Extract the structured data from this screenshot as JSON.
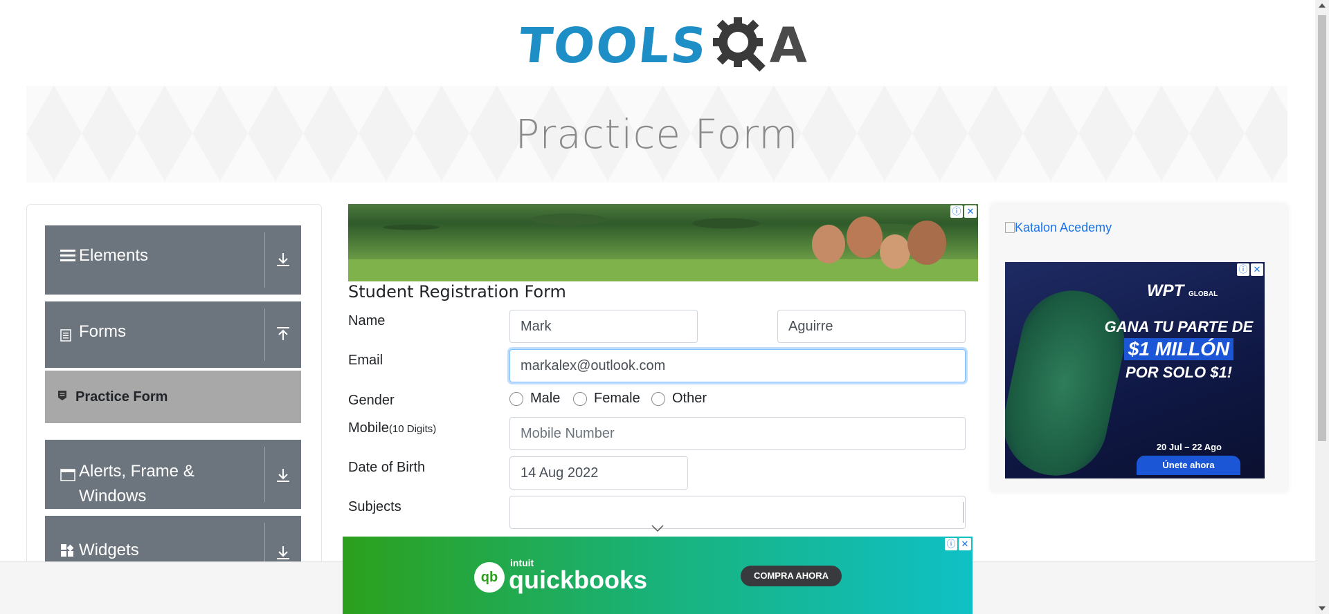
{
  "header": {
    "logo_text_tools": "TOOLS",
    "logo_text_a": "A",
    "logo_brand_color": "#1e8fc6"
  },
  "banner": {
    "title": "Practice Form"
  },
  "sidebar": {
    "groups": [
      {
        "label": "Elements",
        "icon": "hamburger-icon",
        "arrow": "download-icon"
      },
      {
        "label": "Forms",
        "icon": "document-icon",
        "arrow": "upload-icon"
      },
      {
        "label": "Alerts, Frame & Windows",
        "icon": "window-icon",
        "arrow": "download-icon"
      },
      {
        "label": "Widgets",
        "icon": "widgets-icon",
        "arrow": "download-icon"
      }
    ],
    "forms_items": [
      {
        "label": "Practice Form",
        "icon": "form-icon",
        "active": true
      }
    ]
  },
  "form": {
    "title": "Student Registration Form",
    "name_label": "Name",
    "first_name": "Mark",
    "last_name": "Aguirre",
    "email_label": "Email",
    "email": "markalex@outlook.com",
    "gender_label": "Gender",
    "gender_options": [
      "Male",
      "Female",
      "Other"
    ],
    "mobile_label": "Mobile",
    "mobile_hint": "(10 Digits)",
    "mobile_placeholder": "Mobile Number",
    "dob_label": "Date of Birth",
    "dob": "14 Aug 2022",
    "subjects_label": "Subjects",
    "subjects": ""
  },
  "ads": {
    "katalon_alt": "Katalon Acedemy",
    "wpt": {
      "brand": "WPT",
      "brand_sub": "GLOBAL",
      "headline_1": "GANA TU PARTE DE",
      "headline_2": "$1 MILLÓN",
      "headline_3": "POR SOLO $1!",
      "dates": "20 Jul – 22 Ago",
      "cta": "Únete ahora"
    },
    "quickbooks": {
      "intuit": "intuit",
      "brand": "quickbooks",
      "cta": "COMPRA AHORA"
    },
    "info_glyph": "ⓘ",
    "close_glyph": "✕"
  },
  "colors": {
    "sidebar_group_bg": "#6c757d",
    "sidebar_active_bg": "#a8a8a8",
    "focus_border": "#80bdff",
    "link_blue": "#1a73e8"
  }
}
